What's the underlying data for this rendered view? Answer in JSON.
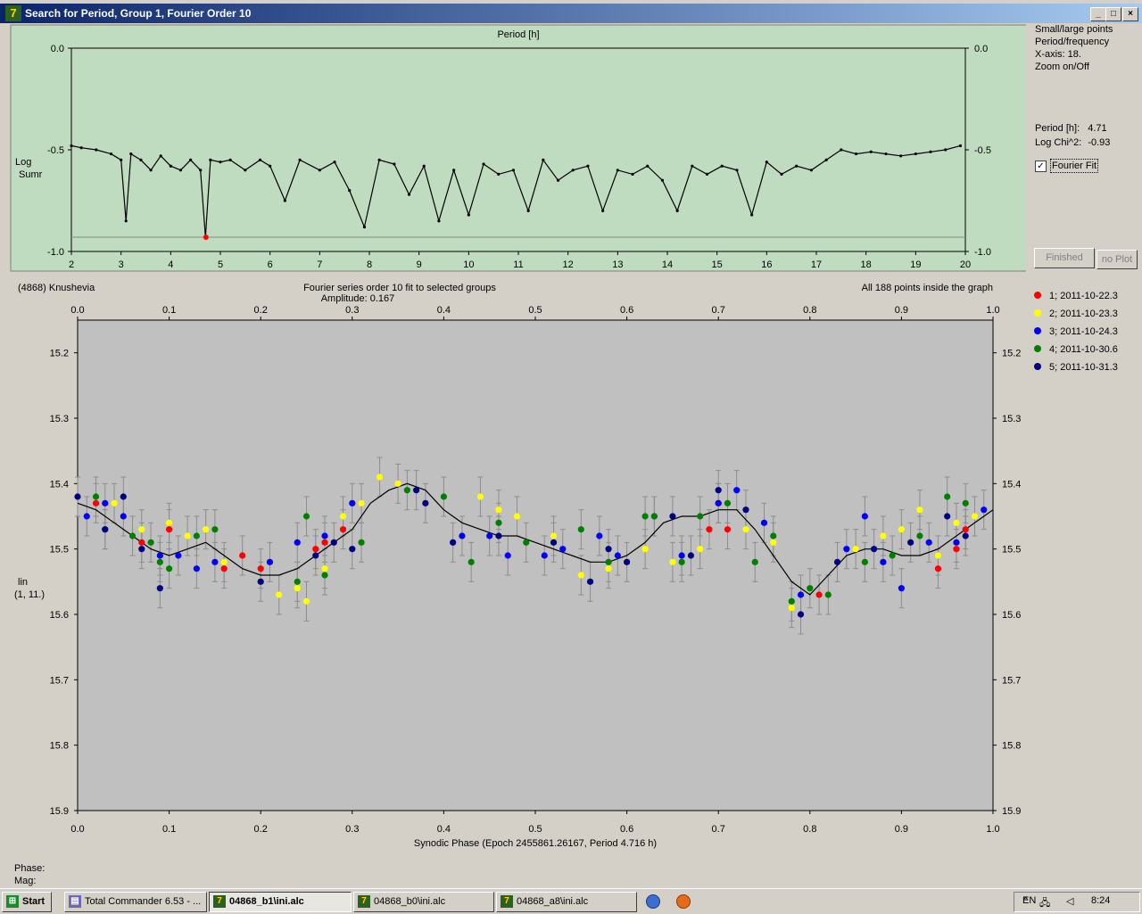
{
  "window": {
    "title": "Search for Period, Group 1, Fourier Order 10"
  },
  "top_panel": {
    "sidebar": {
      "line1": "Small/large points",
      "line2": "Period/frequency",
      "line3": "X-axis: 18.",
      "line4": "Zoom on/Off",
      "period_label": "Period [h]:",
      "period_value": "4.71",
      "chi_label": "Log Chi^2:",
      "chi_value": "-0.93",
      "fourier_fit_label": "Fourier Fit",
      "fourier_fit_checked": true
    },
    "finished_button": "Finished",
    "noplot_button": "no Plot"
  },
  "bottom_panel": {
    "phase_label": "Phase:",
    "mag_label": "Mag:"
  },
  "taskbar": {
    "start": "Start",
    "tasks": [
      "Total Commander 6.53 - ...",
      "04868_b1\\ini.alc",
      "04868_b0\\ini.alc",
      "04868_a8\\ini.alc"
    ],
    "active_index": 1,
    "lang": "EN",
    "time": "8:24"
  },
  "chart_data": [
    {
      "type": "scatter",
      "title": "Period [h]",
      "ylabel": "Log Sumr",
      "xlim": [
        2,
        20
      ],
      "ylim": [
        -1.0,
        0.0
      ],
      "xticks": [
        2,
        3,
        4,
        5,
        6,
        7,
        8,
        9,
        10,
        11,
        12,
        13,
        14,
        15,
        16,
        17,
        18,
        19,
        20
      ],
      "yticks": [
        "0.0",
        "-0.5",
        "-1.0"
      ],
      "grid": false,
      "background": "#c0dcc0",
      "reference_line": -0.93,
      "best_point": {
        "x": 4.71,
        "y": -0.93,
        "color": "#ff0000"
      },
      "series": [
        {
          "x": [
            2.0,
            2.2,
            2.5,
            2.8,
            3.0,
            3.1,
            3.2,
            3.4,
            3.6,
            3.8,
            4.0,
            4.2,
            4.4,
            4.6,
            4.7,
            4.8,
            5.0,
            5.2,
            5.5,
            5.8,
            6.0,
            6.3,
            6.6,
            7.0,
            7.3,
            7.6,
            7.9,
            8.2,
            8.5,
            8.8,
            9.1,
            9.4,
            9.7,
            10.0,
            10.3,
            10.6,
            10.9,
            11.2,
            11.5,
            11.8,
            12.1,
            12.4,
            12.7,
            13.0,
            13.3,
            13.6,
            13.9,
            14.2,
            14.5,
            14.8,
            15.1,
            15.4,
            15.7,
            16.0,
            16.3,
            16.6,
            16.9,
            17.2,
            17.5,
            17.8,
            18.1,
            18.4,
            18.7,
            19.0,
            19.3,
            19.6,
            19.9
          ],
          "y": [
            -0.48,
            -0.49,
            -0.5,
            -0.52,
            -0.55,
            -0.85,
            -0.52,
            -0.55,
            -0.6,
            -0.53,
            -0.58,
            -0.6,
            -0.55,
            -0.6,
            -0.93,
            -0.55,
            -0.56,
            -0.55,
            -0.6,
            -0.55,
            -0.58,
            -0.75,
            -0.55,
            -0.6,
            -0.56,
            -0.7,
            -0.88,
            -0.55,
            -0.57,
            -0.72,
            -0.58,
            -0.85,
            -0.6,
            -0.82,
            -0.57,
            -0.62,
            -0.6,
            -0.8,
            -0.55,
            -0.65,
            -0.6,
            -0.58,
            -0.8,
            -0.6,
            -0.62,
            -0.58,
            -0.65,
            -0.8,
            -0.58,
            -0.62,
            -0.58,
            -0.6,
            -0.82,
            -0.56,
            -0.62,
            -0.58,
            -0.6,
            -0.55,
            -0.5,
            -0.52,
            -0.51,
            -0.52,
            -0.53,
            -0.52,
            -0.51,
            -0.5,
            -0.48
          ]
        }
      ]
    },
    {
      "type": "scatter",
      "title": "(4868) Knushevia",
      "subtitle": "Fourier series order 10 fit to selected groups",
      "amplitude": "Amplitude: 0.167",
      "note": "All 188 points inside the graph",
      "xlabel": "Synodic Phase (Epoch 2455861.26167, Period 4.716 h)",
      "ylabel": "lin",
      "ylabel2": "(1, 11.)",
      "xlim": [
        0.0,
        1.0
      ],
      "ylim": [
        15.9,
        15.15
      ],
      "xticks": [
        "0.0",
        "0.1",
        "0.2",
        "0.3",
        "0.4",
        "0.5",
        "0.6",
        "0.7",
        "0.8",
        "0.9",
        "1.0"
      ],
      "yticks": [
        "15.2",
        "15.3",
        "15.4",
        "15.5",
        "15.6",
        "15.7",
        "15.8",
        "15.9"
      ],
      "background": "#c0c0c0",
      "fit_curve": {
        "x": [
          0.0,
          0.02,
          0.04,
          0.06,
          0.08,
          0.1,
          0.12,
          0.14,
          0.16,
          0.18,
          0.2,
          0.22,
          0.24,
          0.26,
          0.28,
          0.3,
          0.32,
          0.34,
          0.36,
          0.38,
          0.4,
          0.42,
          0.44,
          0.46,
          0.48,
          0.5,
          0.52,
          0.54,
          0.56,
          0.58,
          0.6,
          0.62,
          0.64,
          0.66,
          0.68,
          0.7,
          0.72,
          0.74,
          0.76,
          0.78,
          0.8,
          0.82,
          0.84,
          0.86,
          0.88,
          0.9,
          0.92,
          0.94,
          0.96,
          0.98,
          1.0
        ],
        "y": [
          15.43,
          15.44,
          15.46,
          15.48,
          15.5,
          15.51,
          15.5,
          15.49,
          15.51,
          15.53,
          15.54,
          15.54,
          15.53,
          15.51,
          15.49,
          15.47,
          15.43,
          15.41,
          15.4,
          15.41,
          15.44,
          15.46,
          15.47,
          15.48,
          15.48,
          15.49,
          15.5,
          15.51,
          15.52,
          15.52,
          15.51,
          15.49,
          15.46,
          15.45,
          15.45,
          15.44,
          15.44,
          15.47,
          15.51,
          15.55,
          15.57,
          15.54,
          15.51,
          15.5,
          15.5,
          15.51,
          15.51,
          15.5,
          15.48,
          15.46,
          15.44
        ]
      },
      "series": [
        {
          "name": "1; 2011-10-22.3",
          "color": "#ff0000",
          "x": [
            0.02,
            0.07,
            0.1,
            0.16,
            0.18,
            0.2,
            0.26,
            0.27,
            0.29,
            0.69,
            0.71,
            0.7,
            0.81,
            0.94,
            0.96,
            0.97
          ],
          "y": [
            15.43,
            15.49,
            15.47,
            15.53,
            15.51,
            15.53,
            15.5,
            15.49,
            15.47,
            15.47,
            15.47,
            15.43,
            15.57,
            15.53,
            15.5,
            15.47
          ]
        },
        {
          "name": "2; 2011-10-23.3",
          "color": "#ffff00",
          "x": [
            0.04,
            0.07,
            0.1,
            0.12,
            0.14,
            0.16,
            0.22,
            0.24,
            0.25,
            0.27,
            0.29,
            0.31,
            0.33,
            0.35,
            0.44,
            0.46,
            0.48,
            0.52,
            0.55,
            0.58,
            0.62,
            0.65,
            0.68,
            0.73,
            0.76,
            0.78,
            0.85,
            0.88,
            0.9,
            0.92,
            0.94,
            0.96,
            0.98
          ],
          "y": [
            15.43,
            15.47,
            15.46,
            15.48,
            15.47,
            15.52,
            15.57,
            15.56,
            15.58,
            15.53,
            15.45,
            15.43,
            15.39,
            15.4,
            15.42,
            15.44,
            15.45,
            15.48,
            15.54,
            15.53,
            15.5,
            15.52,
            15.5,
            15.47,
            15.49,
            15.59,
            15.5,
            15.48,
            15.47,
            15.44,
            15.51,
            15.46,
            15.45
          ]
        },
        {
          "name": "3; 2011-10-24.3",
          "color": "#0000ff",
          "x": [
            0.01,
            0.03,
            0.05,
            0.09,
            0.11,
            0.13,
            0.15,
            0.21,
            0.24,
            0.27,
            0.3,
            0.42,
            0.45,
            0.47,
            0.51,
            0.53,
            0.57,
            0.59,
            0.63,
            0.66,
            0.7,
            0.72,
            0.75,
            0.79,
            0.84,
            0.86,
            0.88,
            0.9,
            0.93,
            0.96,
            0.99
          ],
          "y": [
            15.45,
            15.43,
            15.45,
            15.51,
            15.51,
            15.53,
            15.52,
            15.52,
            15.49,
            15.48,
            15.43,
            15.48,
            15.48,
            15.51,
            15.51,
            15.5,
            15.48,
            15.51,
            15.45,
            15.51,
            15.43,
            15.41,
            15.46,
            15.57,
            15.5,
            15.45,
            15.52,
            15.56,
            15.49,
            15.49,
            15.44
          ]
        },
        {
          "name": "4; 2011-10-30.6",
          "color": "#008000",
          "x": [
            0.02,
            0.03,
            0.06,
            0.08,
            0.09,
            0.1,
            0.13,
            0.15,
            0.24,
            0.25,
            0.27,
            0.31,
            0.36,
            0.4,
            0.43,
            0.46,
            0.49,
            0.55,
            0.58,
            0.62,
            0.63,
            0.66,
            0.68,
            0.71,
            0.74,
            0.76,
            0.78,
            0.8,
            0.82,
            0.86,
            0.89,
            0.92,
            0.95,
            0.97
          ],
          "y": [
            15.42,
            15.47,
            15.48,
            15.49,
            15.52,
            15.53,
            15.48,
            15.47,
            15.55,
            15.45,
            15.54,
            15.49,
            15.41,
            15.42,
            15.52,
            15.46,
            15.49,
            15.47,
            15.52,
            15.45,
            15.45,
            15.52,
            15.45,
            15.43,
            15.52,
            15.48,
            15.58,
            15.56,
            15.57,
            15.52,
            15.51,
            15.48,
            15.42,
            15.43
          ]
        },
        {
          "name": "5; 2011-10-31.3",
          "color": "#000080",
          "x": [
            0.0,
            0.03,
            0.05,
            0.07,
            0.09,
            0.2,
            0.26,
            0.28,
            0.3,
            0.37,
            0.38,
            0.41,
            0.46,
            0.52,
            0.56,
            0.58,
            0.6,
            0.65,
            0.67,
            0.7,
            0.73,
            0.79,
            0.83,
            0.87,
            0.91,
            0.95,
            0.97
          ],
          "y": [
            15.42,
            15.47,
            15.42,
            15.5,
            15.56,
            15.55,
            15.51,
            15.49,
            15.5,
            15.41,
            15.43,
            15.49,
            15.48,
            15.49,
            15.55,
            15.5,
            15.52,
            15.45,
            15.51,
            15.41,
            15.44,
            15.6,
            15.52,
            15.5,
            15.49,
            15.45,
            15.48
          ]
        }
      ]
    }
  ]
}
